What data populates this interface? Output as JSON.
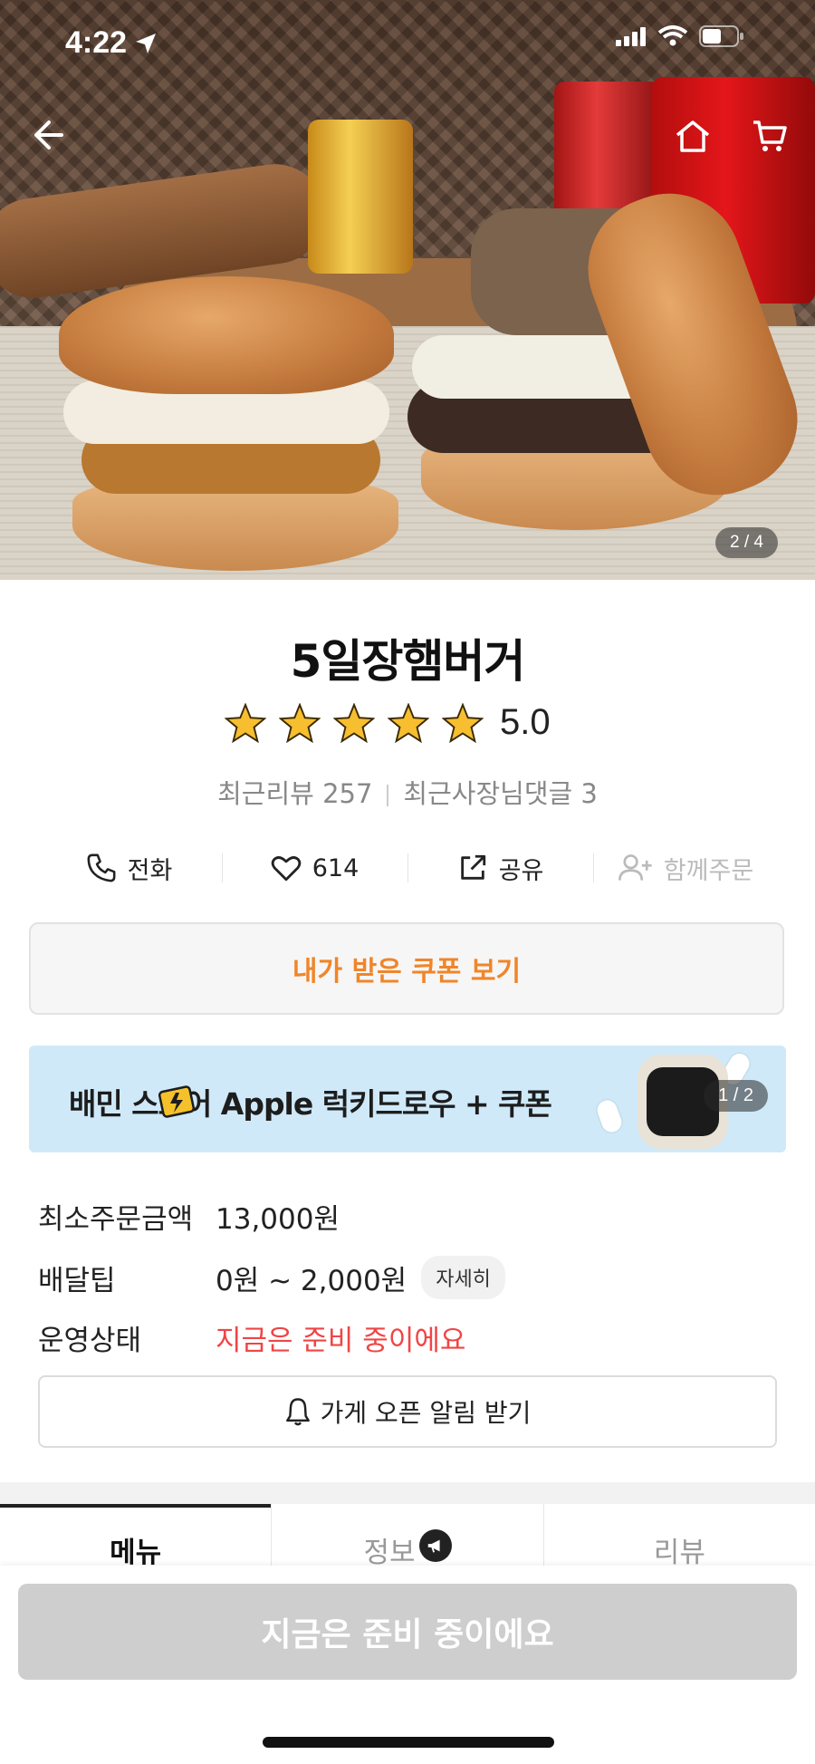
{
  "status_bar": {
    "time": "4:22"
  },
  "hero": {
    "pager": "2 / 4"
  },
  "store": {
    "name": "5일장햄버거",
    "rating": "5.0",
    "star_count": 5,
    "recent_reviews": "최근리뷰 257",
    "owner_comments": "최근사장님댓글 3"
  },
  "actions": [
    {
      "label": "전화",
      "icon": "phone-icon"
    },
    {
      "label": "614",
      "icon": "heart-icon"
    },
    {
      "label": "공유",
      "icon": "share-icon"
    },
    {
      "label": "함께주문",
      "icon": "add-user-icon"
    }
  ],
  "coupon_button": "내가 받은 쿠폰 보기",
  "banner": {
    "text": "배민  스토어 Apple 럭키드로우 + 쿠폰",
    "pager": "1 / 2"
  },
  "info": {
    "min_order_label": "최소주문금액",
    "min_order_value": "13,000원",
    "delivery_tip_label": "배달팁",
    "delivery_tip_value": "0원 ~ 2,000원",
    "detail_chip": "자세히",
    "status_label": "운영상태",
    "status_value": "지금은 준비 중이에요"
  },
  "notify_button": "가게 오픈 알림 받기",
  "tabs": [
    {
      "label": "메뉴"
    },
    {
      "label": "정보"
    },
    {
      "label": "리뷰"
    }
  ],
  "order_button": "지금은 준비 중이에요",
  "colors": {
    "accent_orange": "#f0852a",
    "status_red": "#f04545",
    "banner_bg": "#cfe9f9",
    "disabled_button": "#cecece"
  }
}
